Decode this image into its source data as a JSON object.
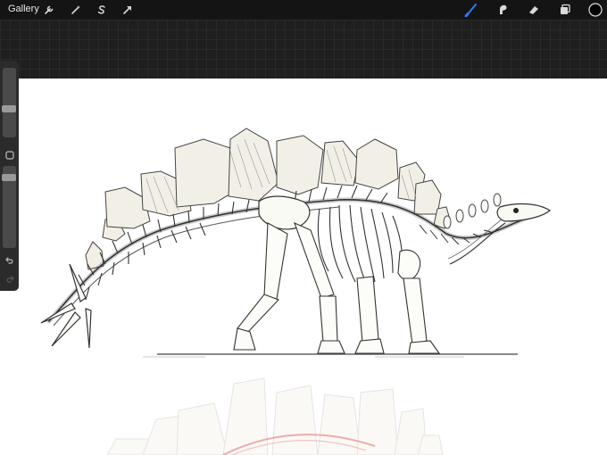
{
  "toolbar": {
    "gallery_label": "Gallery",
    "left_tools": [
      "wrench-icon",
      "magic-wand-icon",
      "selection-s-icon",
      "transform-arrow-icon"
    ],
    "right_tools": [
      "brush-icon",
      "smudge-icon",
      "eraser-icon",
      "layers-icon",
      "color-swatch"
    ],
    "active_color": "#000000",
    "accent": "#2f7cf6"
  },
  "sidebar": {
    "brush_size": 0.15,
    "opacity": 1.0
  }
}
